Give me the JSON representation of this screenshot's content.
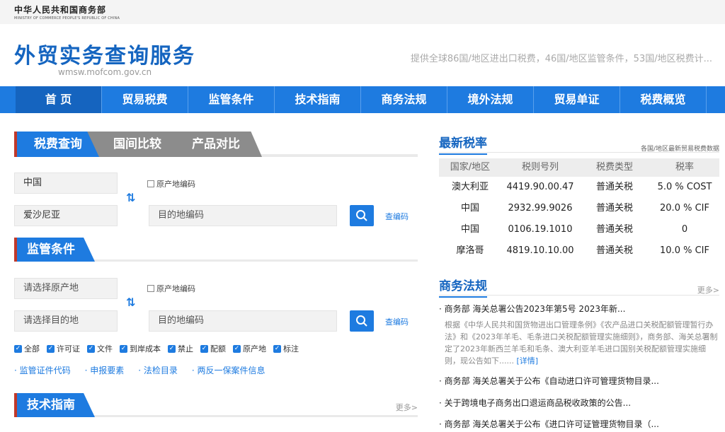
{
  "ministry": {
    "cn": "中华人民共和国商务部",
    "en": "MINISTRY OF COMMERCE PEOPLE'S REPUBLIC OF CHINA"
  },
  "site": {
    "title": "外贸实务查询服务",
    "url": "wmsw.mofcom.gov.cn",
    "tagline": "提供全球86国/地区进出口税费，46国/地区监管条件，53国/地区税费计..."
  },
  "nav": [
    "首 页",
    "贸易税费",
    "监管条件",
    "技术指南",
    "商务法规",
    "境外法规",
    "贸易单证",
    "税费概览"
  ],
  "tabs": [
    "税费查询",
    "国间比较",
    "产品对比"
  ],
  "tax_query": {
    "origin": "中国",
    "dest": "爱沙尼亚",
    "origin_code_label": "原产地编码",
    "dest_code_placeholder": "目的地编码",
    "check_code": "查编码"
  },
  "regulation": {
    "title": "监管条件",
    "origin_placeholder": "请选择原产地",
    "dest_placeholder": "请选择目的地",
    "origin_code_label": "原产地编码",
    "dest_code_placeholder": "目的地编码",
    "check_code": "查编码",
    "filters": [
      "全部",
      "许可证",
      "文件",
      "到岸成本",
      "禁止",
      "配额",
      "原产地",
      "标注"
    ],
    "links": [
      "· 监管证件代码",
      "· 申报要素",
      "· 法检目录",
      "· 两反一保案件信息"
    ]
  },
  "tech_guide": {
    "title": "技术指南",
    "more": "更多>"
  },
  "latest_rates": {
    "title": "最新税率",
    "note": "各国/地区最新贸易税费数据",
    "headers": [
      "国家/地区",
      "税则号列",
      "税费类型",
      "税率"
    ],
    "rows": [
      [
        "澳大利亚",
        "4419.90.00.47",
        "普通关税",
        "5.0 % COST"
      ],
      [
        "中国",
        "2932.99.9026",
        "普通关税",
        "20.0 % CIF"
      ],
      [
        "中国",
        "0106.19.1010",
        "普通关税",
        "0"
      ],
      [
        "摩洛哥",
        "4819.10.10.00",
        "普通关税",
        "10.0 % CIF"
      ]
    ]
  },
  "commerce_law": {
    "title": "商务法规",
    "more": "更多>",
    "items": [
      "· 商务部 海关总署公告2023年第5号 2023年新...",
      "· 商务部 海关总署关于公布《自动进口许可管理货物目录...",
      "· 关于跨境电子商务出口退运商品税收政策的公告...",
      "· 商务部 海关总署关于公布《进口许可证管理货物目录（..."
    ],
    "desc": "根据《中华人民共和国货物进出口管理条例》《农产品进口关税配额管理暂行办法》和《2023年羊毛、毛条进口关税配额管理实施细则》，商务部、海关总署制定了2023年新西兰羊毛和毛条、澳大利亚羊毛进口国别关税配额管理实施细则，现公告如下......",
    "detail": "[详情]"
  }
}
